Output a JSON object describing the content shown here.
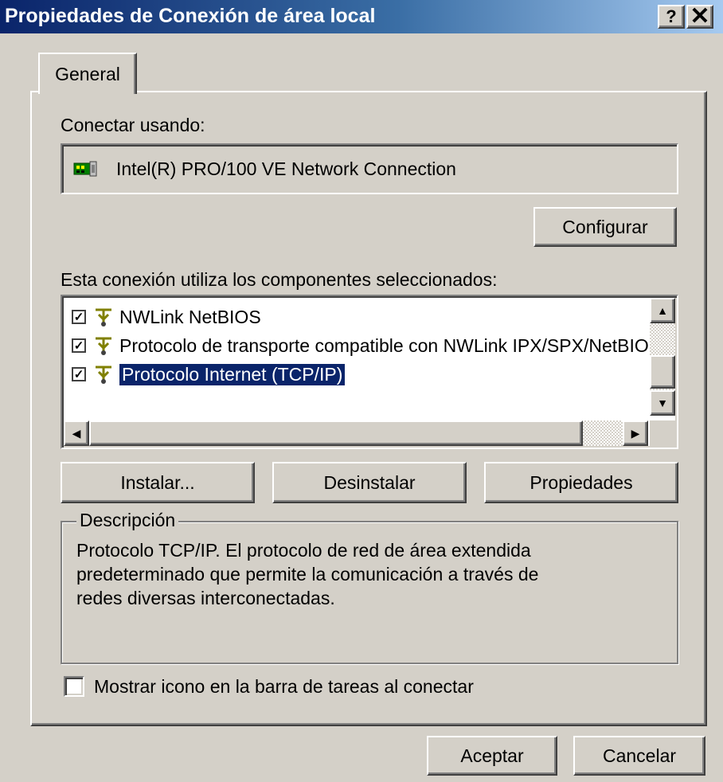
{
  "window": {
    "title": "Propiedades de Conexión de área local",
    "help_label": "?",
    "close_label": "×"
  },
  "tabs": [
    {
      "label": "General",
      "active": true
    }
  ],
  "connect": {
    "label": "Conectar usando:",
    "adapter": "Intel(R) PRO/100 VE Network Connection",
    "adapter_icon": "network-card-icon",
    "configure_button": "Configurar"
  },
  "components": {
    "label": "Esta conexión utiliza los componentes seleccionados:",
    "items": [
      {
        "label": "NWLink NetBIOS",
        "checked": true,
        "icon": "network-protocol-icon"
      },
      {
        "label": "Protocolo de transporte compatible con NWLink IPX/SPX/NetBIOS",
        "checked": true,
        "icon": "network-protocol-icon"
      },
      {
        "label": "Protocolo Internet (TCP/IP)",
        "checked": true,
        "selected": true,
        "icon": "network-protocol-icon"
      }
    ]
  },
  "buttons": {
    "install": "Instalar...",
    "uninstall": "Desinstalar",
    "properties": "Propiedades"
  },
  "description": {
    "legend": "Descripción",
    "lines": [
      "Protocolo TCP/IP. El protocolo de red de área extendida",
      "predeterminado que permite la comunicación a través de",
      "redes diversas interconectadas."
    ]
  },
  "show_icon": {
    "label": "Mostrar icono en la barra de tareas al conectar",
    "checked": false
  },
  "footer": {
    "ok": "Aceptar",
    "cancel": "Cancelar"
  },
  "colors": {
    "titlebar_start": "#0a246a",
    "titlebar_end": "#a6caf0",
    "face": "#d4d0c8",
    "selection": "#0a246a"
  }
}
